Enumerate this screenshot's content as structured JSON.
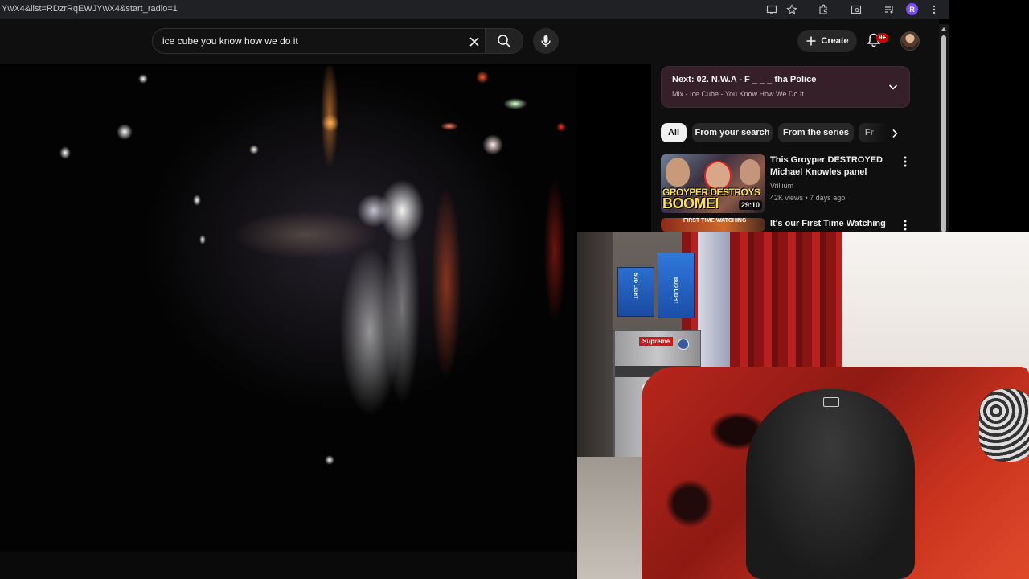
{
  "browser": {
    "url": "YwX4&list=RDzrRqEWJYwX4&start_radio=1",
    "profile_initial": "R",
    "icons": [
      "cast-icon",
      "bookmark-star-icon",
      "extensions-icon",
      "tab-search-icon",
      "media-control-icon",
      "more-vert-icon"
    ]
  },
  "masthead": {
    "search_value": "ice cube you know how we do it",
    "create_label": "Create",
    "notification_count": "9+"
  },
  "playlist": {
    "next_label": "Next: 02. N.W.A - F _ _ _ tha Police",
    "subtitle": "Mix - Ice Cube - You Know How We Do It"
  },
  "chips": [
    {
      "label": "All",
      "active": true
    },
    {
      "label": "From your search",
      "active": false
    },
    {
      "label": "From the series",
      "active": false
    },
    {
      "label": "Fr",
      "active": false
    }
  ],
  "recommendations": [
    {
      "title": "This Groyper DESTROYED Michael Knowles panel",
      "channel": "Vrillium",
      "meta": "42K views • 7 days ago",
      "duration": "29:10",
      "thumb_text_1": "GROYPER DESTROYS",
      "thumb_text_2": "BOOMEI"
    },
    {
      "title": "It's our First Time Watching",
      "thumb_text_1": "FIRST TIME WATCHING"
    }
  ],
  "webcam_scene": {
    "box_label_1": "BUD LIGHT",
    "box_label_2": "BUD LIGHT",
    "fridge_label": "Supreme"
  },
  "colors": {
    "background": "#0f0f0f",
    "playlist_bg": "#35202a",
    "notification_red": "#cc0000",
    "bedding_red": "#b8261c"
  }
}
